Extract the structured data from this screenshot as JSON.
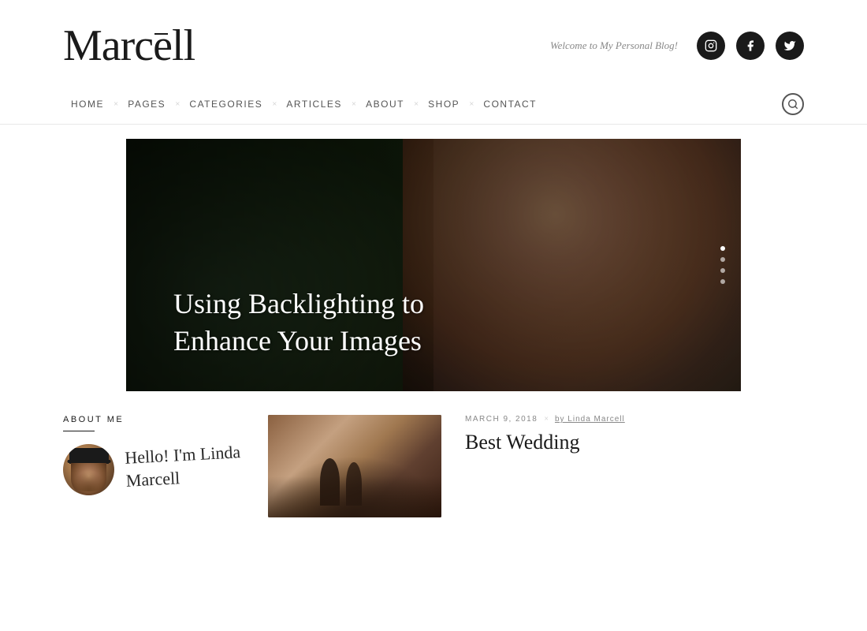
{
  "header": {
    "logo": "Marcēll",
    "logo_text": "Marcell",
    "tagline": "Welcome to My Personal Blog!",
    "social": [
      {
        "name": "instagram",
        "icon": "📷",
        "symbol": "IG"
      },
      {
        "name": "facebook",
        "icon": "f",
        "symbol": "f"
      },
      {
        "name": "twitter",
        "icon": "🐦",
        "symbol": "t"
      }
    ]
  },
  "nav": {
    "items": [
      {
        "label": "HOME",
        "active": true
      },
      {
        "label": "PAGES"
      },
      {
        "label": "CATEGORIES"
      },
      {
        "label": "ARTICLES"
      },
      {
        "label": "ABOUT"
      },
      {
        "label": "SHOP"
      },
      {
        "label": "CONTACT"
      }
    ],
    "search_icon": "search"
  },
  "hero": {
    "title": "Using Backlighting to Enhance Your Images",
    "dots": [
      true,
      false,
      false,
      false
    ]
  },
  "about_section": {
    "title": "ABOUT ME",
    "signature_line1": "Hello! I'm Linda",
    "signature_line2": "Marcell"
  },
  "featured_article": {
    "date": "MARCH 9, 2018",
    "author": "by Linda Marcell",
    "title": "Best Wedding"
  }
}
